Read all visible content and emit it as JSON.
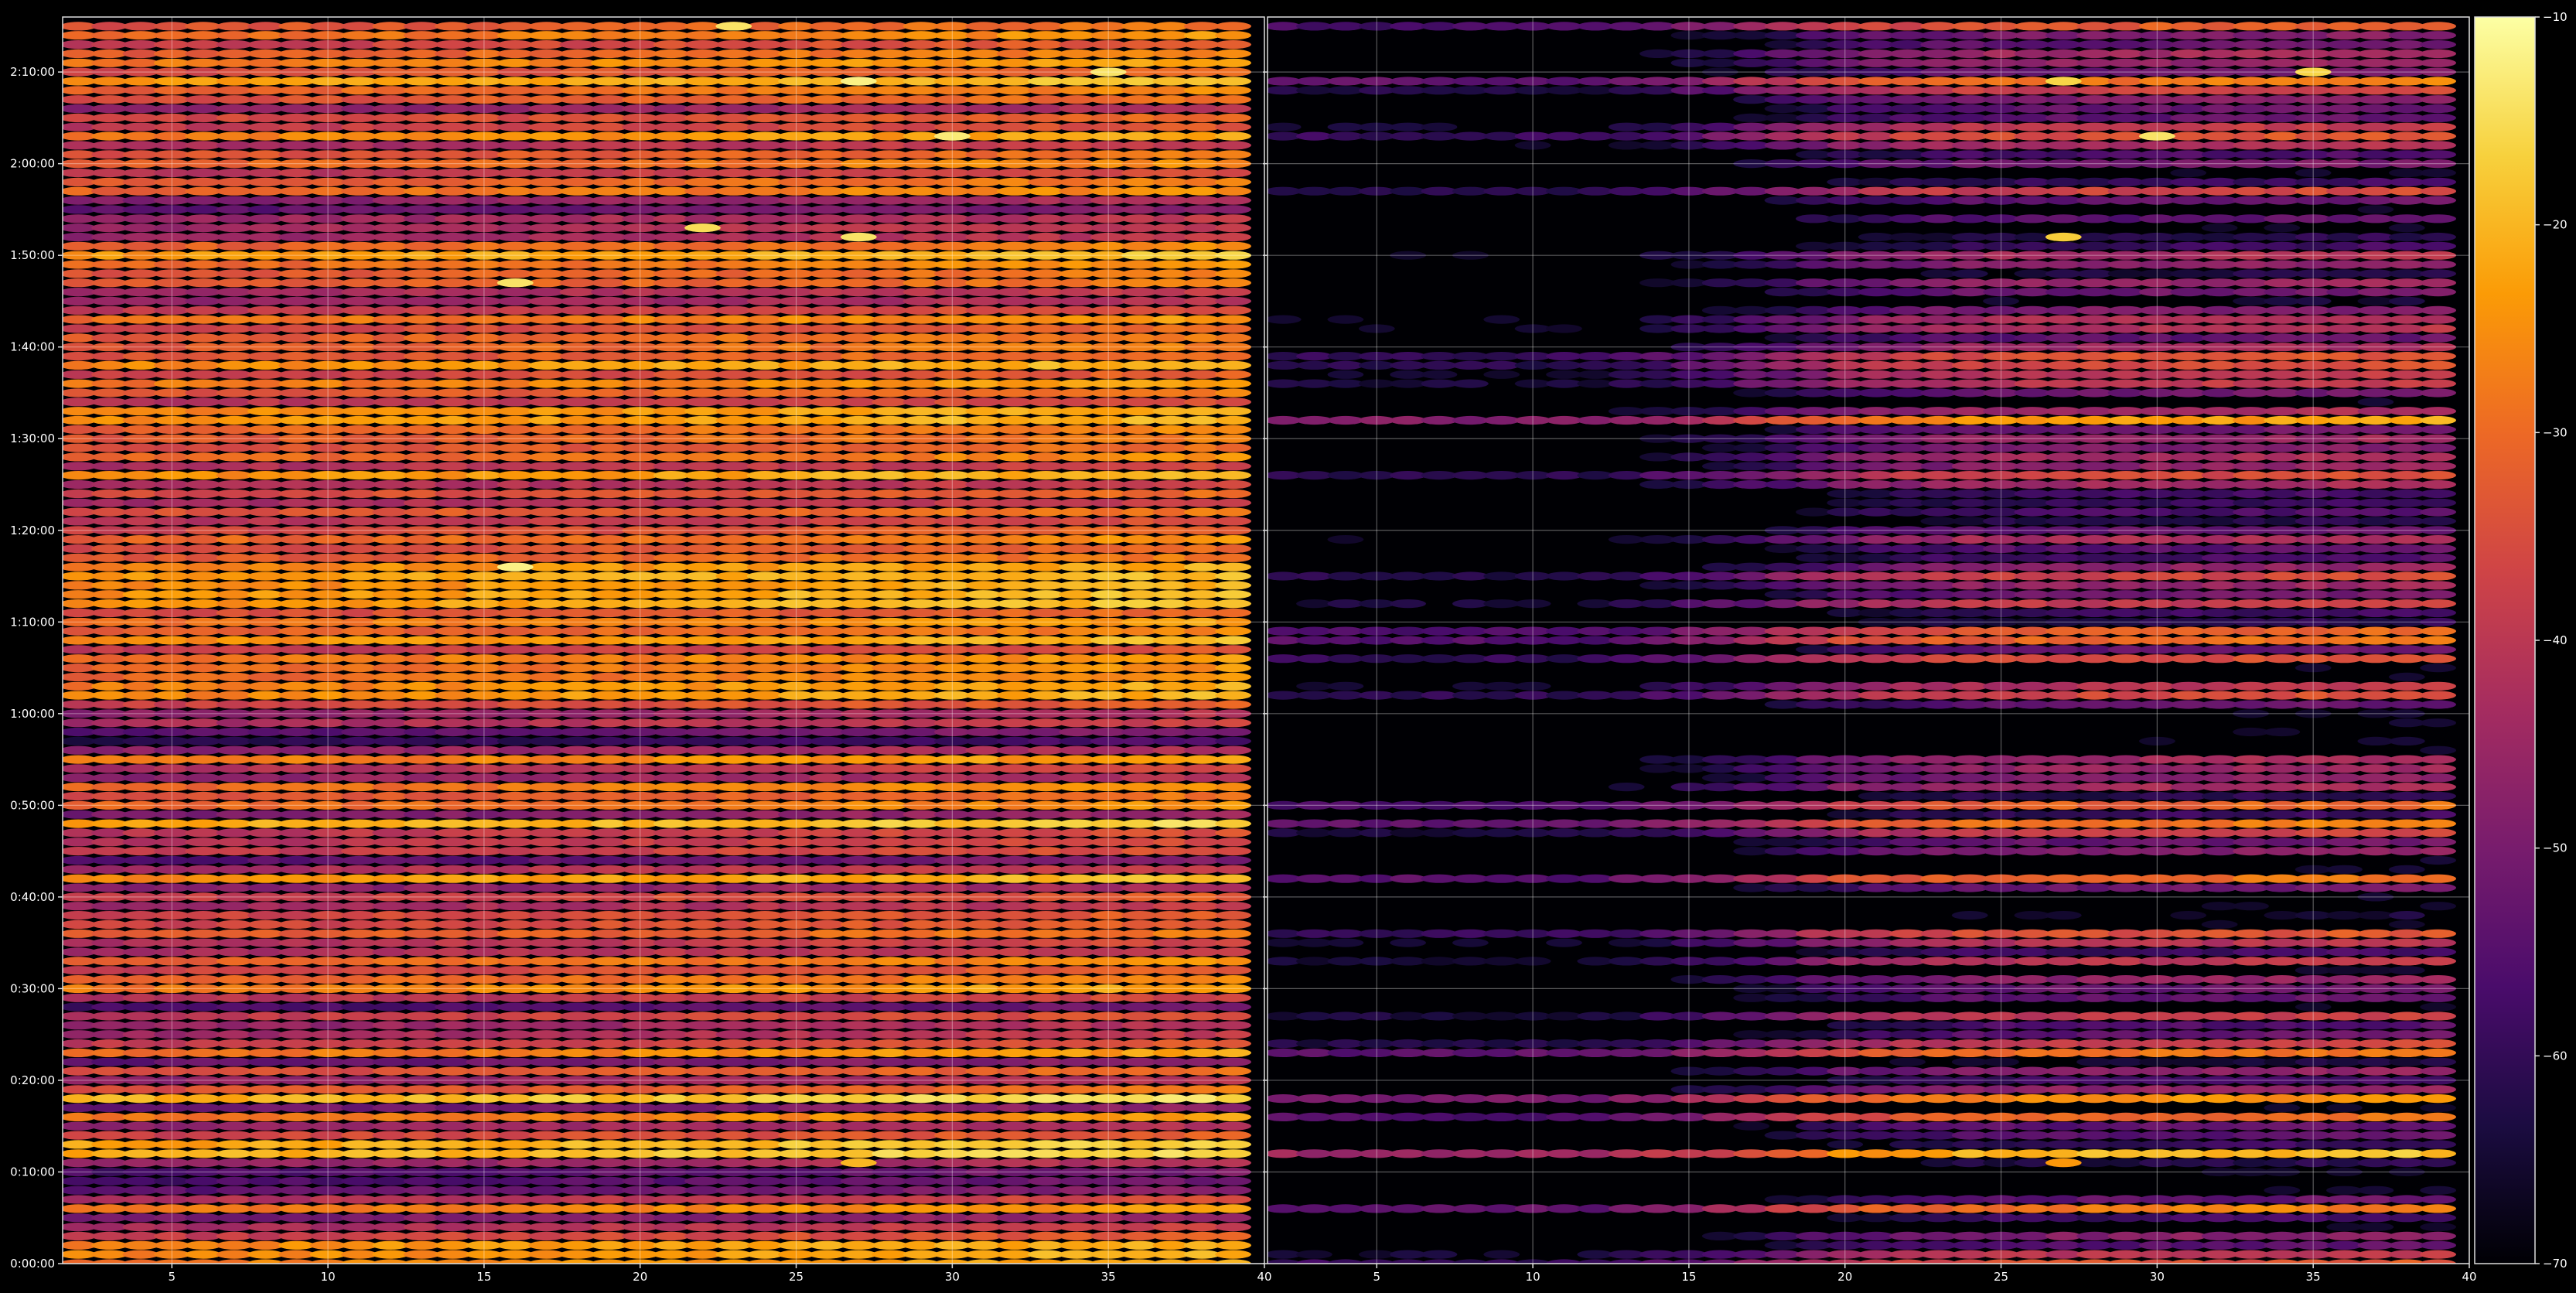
{
  "chart_data": {
    "type": "heatmap",
    "theme": "dark",
    "background_color": "#000000",
    "colormap": "inferno",
    "grid": true,
    "panels": [
      {
        "x_range": [
          1.5,
          40
        ],
        "x_ticks": [
          5,
          10,
          15,
          20,
          25,
          30,
          35,
          40
        ],
        "x_tick_labels": [
          "5",
          "10",
          "15",
          "20",
          "25",
          "30",
          "35",
          "40"
        ]
      },
      {
        "x_range": [
          1.5,
          40
        ],
        "x_ticks": [
          5,
          10,
          15,
          20,
          25,
          30,
          35,
          40
        ],
        "x_tick_labels": [
          "5",
          "10",
          "15",
          "20",
          "25",
          "30",
          "35",
          "40"
        ]
      }
    ],
    "y_ticks_seconds": [
      0,
      600,
      1200,
      1800,
      2400,
      3000,
      3600,
      4200,
      4800,
      5400,
      6000,
      6600,
      7200,
      7800
    ],
    "y_tick_labels": [
      "0:00:00",
      "0:10:00",
      "0:20:00",
      "0:30:00",
      "0:40:00",
      "0:50:00",
      "1:00:00",
      "1:10:00",
      "1:20:00",
      "1:30:00",
      "1:40:00",
      "1:50:00",
      "2:00:00",
      "2:10:00"
    ],
    "y_range_seconds": [
      0,
      8160
    ],
    "x_columns": [
      2,
      3,
      4,
      5,
      6,
      7,
      8,
      9,
      10,
      11,
      12,
      13,
      14,
      15,
      16,
      17,
      18,
      19,
      20,
      21,
      22,
      23,
      24,
      25,
      26,
      27,
      28,
      29,
      30,
      31,
      32,
      33,
      34,
      35,
      36,
      37,
      38,
      39
    ],
    "row_spacing_seconds": 60,
    "colorbar": {
      "range": [
        -70,
        -10
      ],
      "ticks": [
        -70,
        -60,
        -50,
        -40,
        -30,
        -20,
        -10
      ],
      "tick_labels": [
        "−70",
        "−60",
        "−50",
        "−40",
        "−30",
        "−20",
        "−10"
      ],
      "colors": [
        "#000004",
        "#1b0c41",
        "#4a0c6b",
        "#781c6d",
        "#a52c60",
        "#cf4446",
        "#ed6925",
        "#fb9b06",
        "#f7d13d",
        "#fcffa4"
      ]
    },
    "row_levels_dB": {
      "left": [
        -24.9,
        -23.6,
        -23.4,
        -35.9,
        -40.7,
        -48.1,
        -26.1,
        -39.4,
        -51.4,
        -54.5,
        -53.9,
        -44.2,
        -18.5,
        -19.7,
        -34.8,
        -44.4,
        -26.4,
        -49.9,
        -18.1,
        -32.1,
        -44.3,
        -32.9,
        -50.6,
        -26.2,
        -36.8,
        -42.3,
        -44.1,
        -36.8,
        -54.8,
        -39.0,
        -25.0,
        -29.3,
        -35.2,
        -28.4,
        -40.9,
        -39.4,
        -31.0,
        -34.9,
        -35.1,
        -42.3,
        -35.6,
        -46.1,
        -22.5,
        -40.8,
        -53.0,
        -37.2,
        -38.8,
        -38.2,
        -19.4,
        -47.5,
        -28.0,
        -32.1,
        -27.5,
        -44.6,
        -39.8,
        -25.6,
        -44.8,
        -59.3,
        -52.0,
        -40.8,
        -44.8,
        -35.0,
        -23.6,
        -24.6,
        -28.0,
        -28.0,
        -26.7,
        -37.0,
        -23.1,
        -30.1,
        -26.0,
        -33.1,
        -21.7,
        -21.8,
        -23.4,
        -21.5,
        -23.8,
        -30.6,
        -33.2,
        -28.3,
        -34.2,
        -38.1,
        -31.4,
        -40.9,
        -33.5,
        -41.0,
        -22.6,
        -39.8,
        -28.6,
        -32.4,
        -30.6,
        -29.4,
        -22.7,
        -23.7,
        -38.1,
        -31.3,
        -25.8,
        -35.2,
        -23.1,
        -31.9,
        -30.0,
        -30.1,
        -33.9,
        -27.0,
        -37.3,
        -44.4,
        -41.7,
        -31.0,
        -30.8,
        -28.0,
        -21.3,
        -29.3,
        -43.1,
        -42.0,
        -43.2,
        -51.8,
        -45.9,
        -28.0,
        -30.2,
        -38.4,
        -28.5,
        -31.9,
        -41.0,
        -24.5,
        -36.8,
        -34.0,
        -45.1,
        -32.1,
        -29.0,
        -21.2,
        -32.9,
        -25.6,
        -29.8,
        -35.6,
        -27.2,
        -31.4
      ],
      "right": [
        -36.0,
        -42.0,
        -57.0,
        -49.9,
        -70.0,
        -60.0,
        -29.3,
        -55.1,
        -70.0,
        -70.0,
        -70.0,
        -63.9,
        -21.6,
        -61.2,
        -56.2,
        -55.8,
        -32.1,
        -70.0,
        -27.1,
        -48.5,
        -59.5,
        -49.3,
        -66.1,
        -30.7,
        -39.5,
        -55.6,
        -57.8,
        -40.4,
        -70.0,
        -55.2,
        -54.1,
        -48.7,
        -70.0,
        -42.1,
        -60.0,
        -43.2,
        -36.0,
        -70.0,
        -67.4,
        -70.0,
        -70.0,
        -53.9,
        -31.2,
        -70.0,
        -70.0,
        -50.8,
        -54.5,
        -40.3,
        -30.2,
        -60.9,
        -32.8,
        -63.0,
        -45.4,
        -50.0,
        -47.1,
        -45.8,
        -70.0,
        -70.0,
        -70.0,
        -70.0,
        -70.0,
        -55.3,
        -37.3,
        -42.8,
        -70.0,
        -70.0,
        -36.9,
        -55.1,
        -32.0,
        -33.6,
        -64.1,
        -60.7,
        -40.8,
        -53.3,
        -47.8,
        -38.5,
        -49.4,
        -59.0,
        -56.2,
        -44.5,
        -54.8,
        -64.2,
        -58.6,
        -61.4,
        -59.9,
        -45.4,
        -37.9,
        -49.1,
        -45.2,
        -51.1,
        -47.4,
        -53.6,
        -25.4,
        -45.7,
        -70.0,
        -53.5,
        -41.0,
        -41.7,
        -38.1,
        -36.2,
        -46.3,
        -55.6,
        -43.9,
        -44.0,
        -51.3,
        -67.9,
        -53.3,
        -48.1,
        -65.4,
        -49.4,
        -44.8,
        -60.5,
        -63.8,
        -70.0,
        -56.0,
        -70.0,
        -54.9,
        -38.8,
        -61.3,
        -70.0,
        -52.5,
        -58.6,
        -44.4,
        -36.0,
        -41.3,
        -55.5,
        -54.9,
        -50.0,
        -39.2,
        -30.0,
        -53.2,
        -48.2,
        -45.5,
        -54.6,
        -51.3,
        -33.9
      ]
    },
    "column_gradient_dB_per_column": 0.18,
    "column_gradient_reference": 20,
    "right_panel_column_offset_dB": {
      "columns": [
        2,
        12,
        16,
        20,
        24,
        39
      ],
      "offsets": [
        -20,
        -22,
        -14,
        -4,
        0,
        0
      ]
    },
    "highlight_cells": [
      {
        "panel": 0,
        "x": 23,
        "t_seconds": 8100,
        "value_dB": -14
      },
      {
        "panel": 0,
        "x": 27,
        "t_seconds": 7740,
        "value_dB": -12
      },
      {
        "panel": 0,
        "x": 35,
        "t_seconds": 7800,
        "value_dB": -14
      },
      {
        "panel": 0,
        "x": 30,
        "t_seconds": 7380,
        "value_dB": -13
      },
      {
        "panel": 0,
        "x": 22,
        "t_seconds": 6780,
        "value_dB": -15
      },
      {
        "panel": 0,
        "x": 27,
        "t_seconds": 6720,
        "value_dB": -14
      },
      {
        "panel": 0,
        "x": 16,
        "t_seconds": 6420,
        "value_dB": -14
      },
      {
        "panel": 0,
        "x": 16,
        "t_seconds": 4560,
        "value_dB": -12
      },
      {
        "panel": 0,
        "x": 27,
        "t_seconds": 660,
        "value_dB": -20
      },
      {
        "panel": 1,
        "x": 27,
        "t_seconds": 7740,
        "value_dB": -16
      },
      {
        "panel": 1,
        "x": 35,
        "t_seconds": 7800,
        "value_dB": -16
      },
      {
        "panel": 1,
        "x": 30,
        "t_seconds": 7380,
        "value_dB": -14
      },
      {
        "panel": 1,
        "x": 27,
        "t_seconds": 6720,
        "value_dB": -17
      },
      {
        "panel": 1,
        "x": 27,
        "t_seconds": 660,
        "value_dB": -24
      }
    ]
  }
}
